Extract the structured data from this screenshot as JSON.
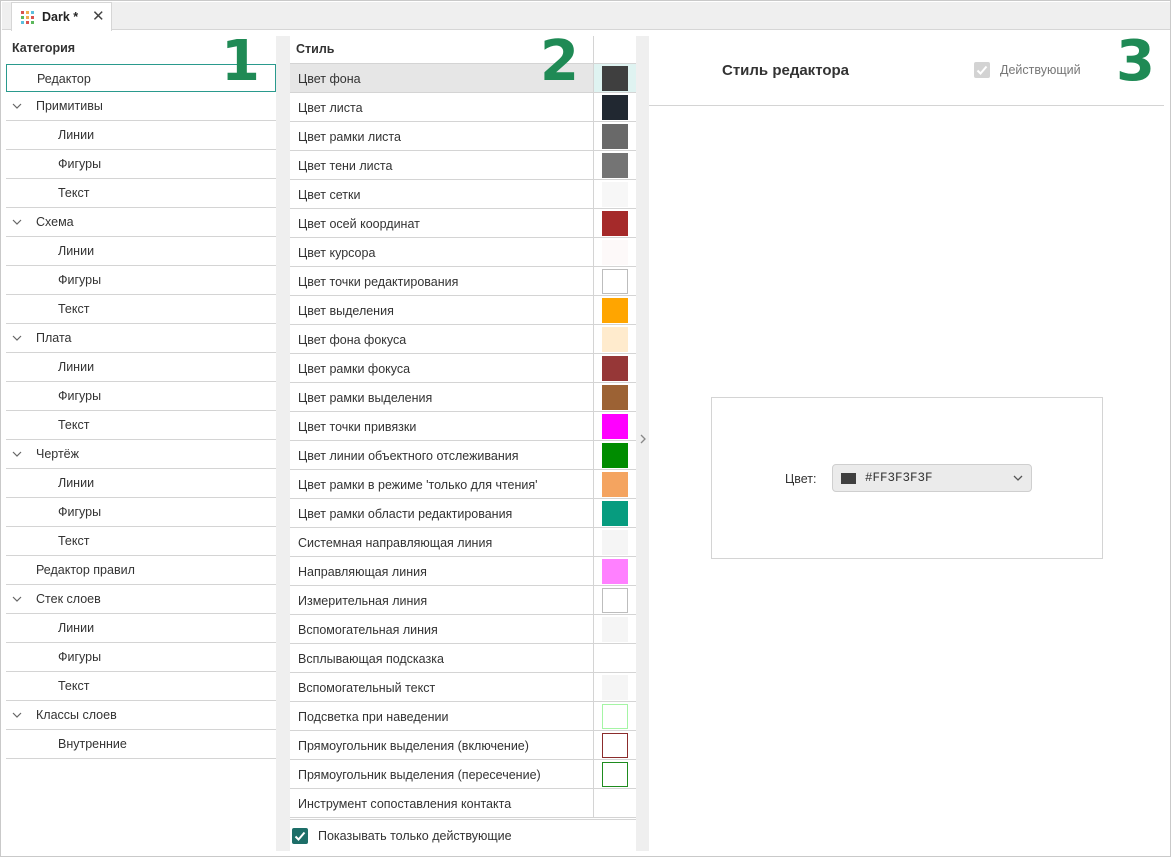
{
  "tab": {
    "title": "Dark *",
    "close_icon": "close-icon",
    "app_icon": "grid-icon"
  },
  "callouts": {
    "n1": "1",
    "n2": "2",
    "n3": "3"
  },
  "categories": {
    "header": "Категория",
    "items": [
      {
        "label": "Редактор",
        "level": 1,
        "expandable": false,
        "selected": true
      },
      {
        "label": "Примитивы",
        "level": 1,
        "expandable": true
      },
      {
        "label": "Линии",
        "level": 2
      },
      {
        "label": "Фигуры",
        "level": 2
      },
      {
        "label": "Текст",
        "level": 2
      },
      {
        "label": "Схема",
        "level": 1,
        "expandable": true
      },
      {
        "label": "Линии",
        "level": 2
      },
      {
        "label": "Фигуры",
        "level": 2
      },
      {
        "label": "Текст",
        "level": 2
      },
      {
        "label": "Плата",
        "level": 1,
        "expandable": true
      },
      {
        "label": "Линии",
        "level": 2
      },
      {
        "label": "Фигуры",
        "level": 2
      },
      {
        "label": "Текст",
        "level": 2
      },
      {
        "label": "Чертёж",
        "level": 1,
        "expandable": true
      },
      {
        "label": "Линии",
        "level": 2
      },
      {
        "label": "Фигуры",
        "level": 2
      },
      {
        "label": "Текст",
        "level": 2
      },
      {
        "label": "Редактор правил",
        "level": 1,
        "expandable": false
      },
      {
        "label": "Стек слоев",
        "level": 1,
        "expandable": true
      },
      {
        "label": "Линии",
        "level": 2
      },
      {
        "label": "Фигуры",
        "level": 2
      },
      {
        "label": "Текст",
        "level": 2
      },
      {
        "label": "Классы слоев",
        "level": 1,
        "expandable": true
      },
      {
        "label": "Внутренние",
        "level": 2
      }
    ]
  },
  "styles": {
    "header": "Стиль",
    "rows": [
      {
        "label": "Цвет фона",
        "color": "#3F3F3F",
        "selected": true
      },
      {
        "label": "Цвет листа",
        "color": "#212831"
      },
      {
        "label": "Цвет рамки листа",
        "color": "#696969"
      },
      {
        "label": "Цвет тени листа",
        "color": "#747474"
      },
      {
        "label": "Цвет сетки",
        "color": "#F7F7F7"
      },
      {
        "label": "Цвет осей координат",
        "color": "#A52A2A"
      },
      {
        "label": "Цвет курсора",
        "color": "#FDF9F9"
      },
      {
        "label": "Цвет точки редактирования",
        "color": "#FFFFFF",
        "outlined": "#BDBDBD"
      },
      {
        "label": "Цвет выделения",
        "color": "#FFA500"
      },
      {
        "label": "Цвет фона фокуса",
        "color": "#FFEBCD"
      },
      {
        "label": "Цвет рамки фокуса",
        "color": "#963737"
      },
      {
        "label": "Цвет рамки выделения",
        "color": "#9C6234"
      },
      {
        "label": "Цвет точки привязки",
        "color": "#FF00FF"
      },
      {
        "label": "Цвет линии объектного отслеживания",
        "color": "#008C00"
      },
      {
        "label": "Цвет рамки в режиме 'только для чтения'",
        "color": "#F4A460"
      },
      {
        "label": "Цвет рамки области редактирования",
        "color": "#079C7F"
      },
      {
        "label": "Системная направляющая линия",
        "color": "#F5F5F5"
      },
      {
        "label": "Направляющая линия",
        "color": "#FF80FF"
      },
      {
        "label": "Измерительная линия",
        "color": "#FFFFFF",
        "outlined": "#BDBDBD"
      },
      {
        "label": "Вспомогательная линия",
        "color": "#F5F5F5"
      },
      {
        "label": "Всплывающая подсказка",
        "color": ""
      },
      {
        "label": "Вспомогательный текст",
        "color": "#F5F5F5"
      },
      {
        "label": "Подсветка при наведении",
        "color": "#FFFFFF",
        "outlined": "#A5F5A5"
      },
      {
        "label": "Прямоугольник выделения (включение)",
        "color": "#FFFFFF",
        "outlined": "#8B2C2C"
      },
      {
        "label": "Прямоугольник выделения (пересечение)",
        "color": "#FFFFFF",
        "outlined": "#1E8B1E"
      },
      {
        "label": "Инструмент сопоставления контакта",
        "color": ""
      }
    ],
    "footer_label": "Показывать только действующие",
    "footer_checked": true
  },
  "editor": {
    "title": "Стиль редактора",
    "active_label": "Действующий",
    "color_label": "Цвет:",
    "color_value": "#FF3F3F3F",
    "color_chip": "#3F3F3F"
  }
}
